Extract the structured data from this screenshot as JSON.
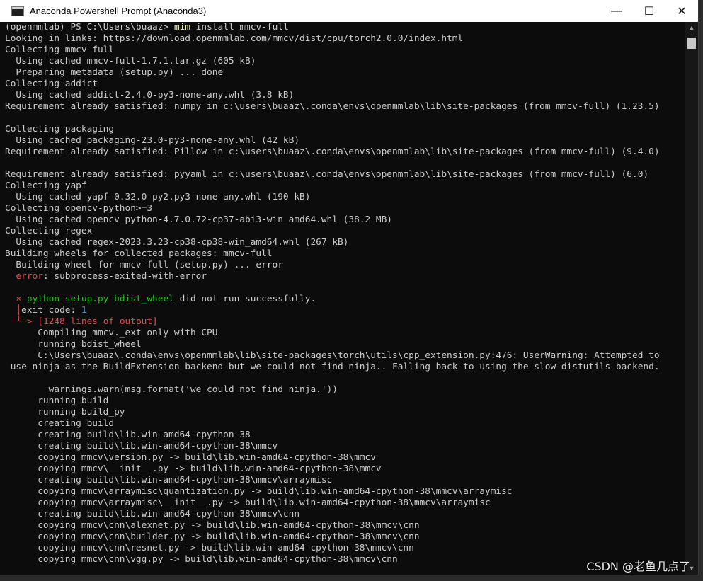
{
  "window": {
    "title": "Anaconda Powershell Prompt (Anaconda3)"
  },
  "buttons": {
    "minimize": "—",
    "maximize": "☐",
    "close": "✕"
  },
  "scrollbar": {
    "up": "▲",
    "down": "▼"
  },
  "colors": {
    "error": "#e74856",
    "green": "#16c60c",
    "text": "#cccccc",
    "background": "#0c0c0c"
  },
  "prompt": {
    "env": "(openmmlab)",
    "ps": "PS C:\\Users\\buaaz>",
    "cmd": "mim",
    "args": "install mmcv-full"
  },
  "block1": [
    "Looking in links: https://download.openmmlab.com/mmcv/dist/cpu/torch2.0.0/index.html",
    "Collecting mmcv-full",
    "  Using cached mmcv-full-1.7.1.tar.gz (605 kB)",
    "  Preparing metadata (setup.py) ... done",
    "Collecting addict",
    "  Using cached addict-2.4.0-py3-none-any.whl (3.8 kB)",
    "Requirement already satisfied: numpy in c:\\users\\buaaz\\.conda\\envs\\openmmlab\\lib\\site-packages (from mmcv-full) (1.23.5)",
    "",
    "Collecting packaging",
    "  Using cached packaging-23.0-py3-none-any.whl (42 kB)",
    "Requirement already satisfied: Pillow in c:\\users\\buaaz\\.conda\\envs\\openmmlab\\lib\\site-packages (from mmcv-full) (9.4.0)",
    "",
    "Requirement already satisfied: pyyaml in c:\\users\\buaaz\\.conda\\envs\\openmmlab\\lib\\site-packages (from mmcv-full) (6.0)",
    "Collecting yapf",
    "  Using cached yapf-0.32.0-py2.py3-none-any.whl (190 kB)",
    "Collecting opencv-python>=3",
    "  Using cached opencv_python-4.7.0.72-cp37-abi3-win_amd64.whl (38.2 MB)",
    "Collecting regex",
    "  Using cached regex-2023.3.23-cp38-cp38-win_amd64.whl (267 kB)",
    "Building wheels for collected packages: mmcv-full",
    "  Building wheel for mmcv-full (setup.py) ... error"
  ],
  "error_line": {
    "label": "error",
    "text": ": subprocess-exited-with-error"
  },
  "fail": {
    "mark": "×",
    "command": "python setup.py bdist_wheel",
    "text": " did not run successfully.",
    "code_label": "exit code: ",
    "code": "1",
    "output": "[1248 lines of output]"
  },
  "block2": [
    "      Compiling mmcv._ext only with CPU",
    "      running bdist_wheel",
    "      C:\\Users\\buaaz\\.conda\\envs\\openmmlab\\lib\\site-packages\\torch\\utils\\cpp_extension.py:476: UserWarning: Attempted to",
    " use ninja as the BuildExtension backend but we could not find ninja.. Falling back to using the slow distutils backend.",
    "",
    "        warnings.warn(msg.format('we could not find ninja.'))",
    "      running build",
    "      running build_py",
    "      creating build",
    "      creating build\\lib.win-amd64-cpython-38",
    "      creating build\\lib.win-amd64-cpython-38\\mmcv",
    "      copying mmcv\\version.py -> build\\lib.win-amd64-cpython-38\\mmcv",
    "      copying mmcv\\__init__.py -> build\\lib.win-amd64-cpython-38\\mmcv",
    "      creating build\\lib.win-amd64-cpython-38\\mmcv\\arraymisc",
    "      copying mmcv\\arraymisc\\quantization.py -> build\\lib.win-amd64-cpython-38\\mmcv\\arraymisc",
    "      copying mmcv\\arraymisc\\__init__.py -> build\\lib.win-amd64-cpython-38\\mmcv\\arraymisc",
    "      creating build\\lib.win-amd64-cpython-38\\mmcv\\cnn",
    "      copying mmcv\\cnn\\alexnet.py -> build\\lib.win-amd64-cpython-38\\mmcv\\cnn",
    "      copying mmcv\\cnn\\builder.py -> build\\lib.win-amd64-cpython-38\\mmcv\\cnn",
    "      copying mmcv\\cnn\\resnet.py -> build\\lib.win-amd64-cpython-38\\mmcv\\cnn",
    "      copying mmcv\\cnn\\vgg.py -> build\\lib.win-amd64-cpython-38\\mmcv\\cnn"
  ],
  "watermark": "CSDN @老鱼几点了"
}
